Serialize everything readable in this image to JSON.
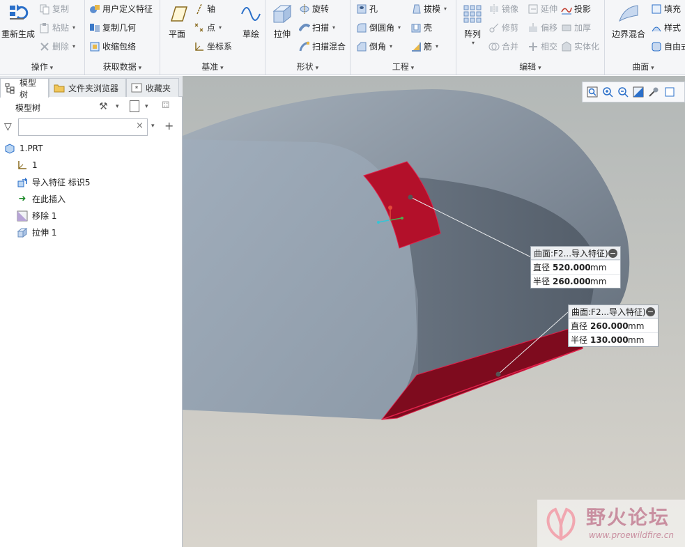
{
  "ribbon": {
    "groups": {
      "operations": {
        "label": "操作",
        "regenerate": "重新生成",
        "copy": "复制",
        "paste": "粘贴",
        "delete": "删除"
      },
      "get_data": {
        "label": "获取数据",
        "udf": "用户定义特征",
        "copy_geometry": "复制几何",
        "shrinkwrap": "收缩包络"
      },
      "datum": {
        "label": "基准",
        "plane": "平面",
        "axis": "轴",
        "point": "点",
        "csys": "坐标系",
        "sketch": "草绘"
      },
      "shapes": {
        "label": "形状",
        "extrude": "拉伸",
        "revolve": "旋转",
        "sweep": "扫描",
        "swept_blend": "扫描混合"
      },
      "engineering": {
        "label": "工程",
        "hole": "孔",
        "round": "倒圆角",
        "chamfer": "倒角",
        "draft": "拔模",
        "shell": "壳",
        "rib": "筋"
      },
      "editing": {
        "label": "编辑",
        "pattern": "阵列",
        "mirror": "镜像",
        "extend": "延伸",
        "project": "投影",
        "trim": "修剪",
        "offset": "偏移",
        "thicken": "加厚",
        "merge": "合并",
        "intersect": "相交",
        "solidify": "实体化"
      },
      "surfaces": {
        "label": "曲面",
        "boundary_blend": "边界混合",
        "fill": "填充",
        "style": "样式",
        "freestyle": "自由式"
      }
    }
  },
  "panel": {
    "tabs": [
      "模型树",
      "文件夹浏览器",
      "收藏夹"
    ],
    "tree_title": "模型树",
    "filter_placeholder": "",
    "items": [
      {
        "label": "1.PRT"
      },
      {
        "label": "1"
      },
      {
        "label": "导入特征 标识5"
      },
      {
        "label": "在此插入"
      },
      {
        "label": "移除 1"
      },
      {
        "label": "拉伸 1"
      }
    ]
  },
  "viewport": {
    "callouts": [
      {
        "title": "曲面:F2...导入特征)",
        "diameter_label": "直径",
        "diameter": "520.000",
        "radius_label": "半径",
        "radius": "260.000",
        "unit": "mm"
      },
      {
        "title": "曲面:F2...导入特征)",
        "diameter_label": "直径",
        "diameter": "260.000",
        "radius_label": "半径",
        "radius": "130.000",
        "unit": "mm"
      }
    ],
    "watermark": {
      "name": "野火论坛",
      "url": "www.proewildfire.cn"
    }
  },
  "colors": {
    "accent": "#1f6fc5",
    "highlight": "#b3102a",
    "model": "#8e9aa8"
  }
}
